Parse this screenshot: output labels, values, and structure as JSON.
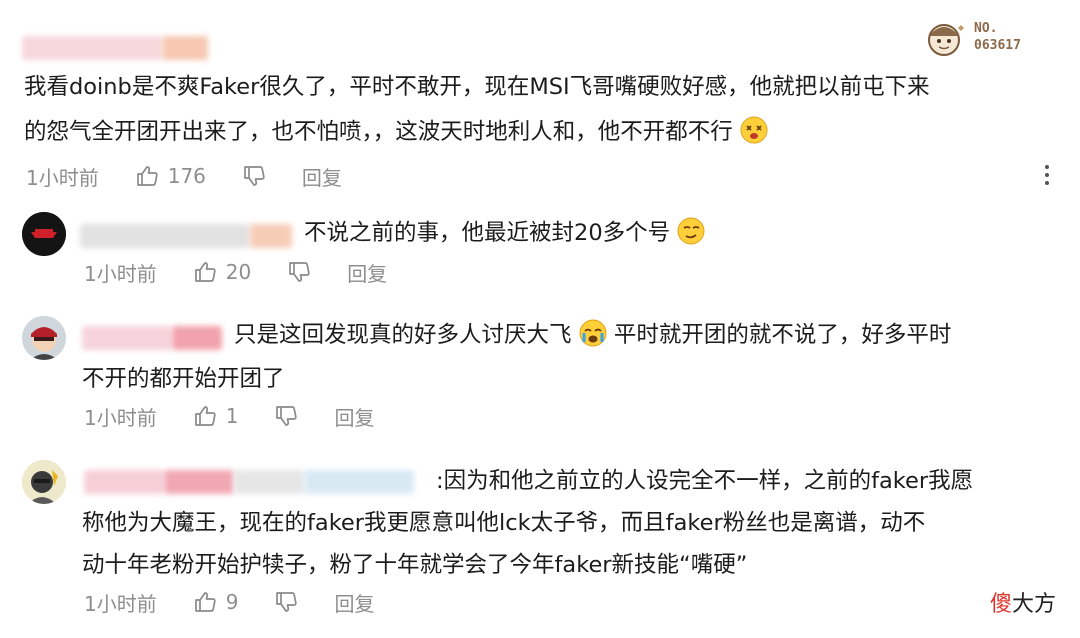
{
  "badge": {
    "number": "NO.\n063617"
  },
  "watermark": {
    "text_red": "傻",
    "text_black": "大方"
  },
  "comments": [
    {
      "lines": [
        "我看doinb是不爽Faker很久了，平时不敢开，现在MSI飞哥嘴硬败好感，他就把以前屯下来",
        "的怨气全开团开出来了，也不怕喷，，这波天时地利人和，他不开都不行"
      ],
      "time": "1小时前",
      "likes": "176",
      "reply_label": "回复",
      "emoji": "dizzy-face"
    },
    {
      "lines": [
        "不说之前的事，他最近被封20多个号"
      ],
      "time": "1小时前",
      "likes": "20",
      "reply_label": "回复",
      "emoji": "smirk-face"
    },
    {
      "lines": [
        "只是这回发现真的好多人讨厌大飞",
        "平时就开团的就不说了，好多平时",
        "不开的都开始开团了"
      ],
      "time": "1小时前",
      "likes": "1",
      "reply_label": "回复",
      "emoji": "crying-face"
    },
    {
      "lines": [
        ":因为和他之前立的人设完全不一样，之前的faker我愿",
        "称他为大魔王，现在的faker我更愿意叫他lck太子爷，而且faker粉丝也是离谱，动不",
        "动十年老粉开始护犊子，粉了十年就学会了今年faker新技能“嘴硬”"
      ],
      "time": "1小时前",
      "likes": "9",
      "reply_label": "回复"
    }
  ],
  "colors": {
    "text": "#1c1c1c",
    "meta": "#8e8e8e",
    "watermark_red": "#e0322c"
  }
}
